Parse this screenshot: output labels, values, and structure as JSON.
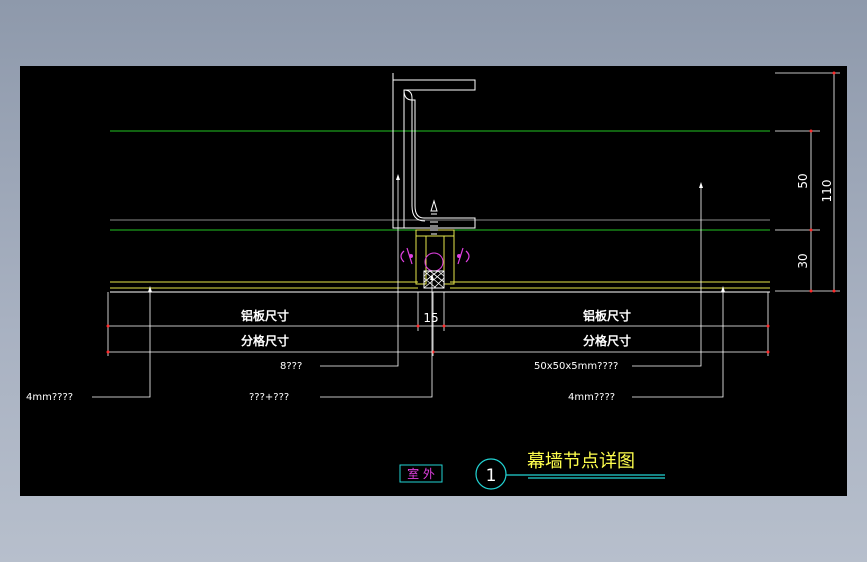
{
  "drawing": {
    "title": "幕墙节点详图",
    "detail_number": "1",
    "outside_label": "室 外",
    "dimensions": {
      "total": "110",
      "upper": "50",
      "lower": "30",
      "joint": "15"
    },
    "left_labels": {
      "panel_size": "铝板尺寸",
      "grid_size": "分格尺寸"
    },
    "right_labels": {
      "panel_size": "铝板尺寸",
      "grid_size": "分格尺寸"
    },
    "leaders": {
      "left_panel": "4mm????",
      "bolt": "8???",
      "sealant": "???+???",
      "angle": "50x50x5mm????",
      "right_panel": "4mm????"
    }
  },
  "colors": {
    "background": "#000000",
    "green_line": "#22c522",
    "yellow_line": "#e6e64a",
    "white_line": "#ffffff",
    "dim_red": "#ff2a2a",
    "magenta": "#e040e0",
    "cyan": "#22d4d4",
    "title_yellow": "#ffff4d"
  }
}
